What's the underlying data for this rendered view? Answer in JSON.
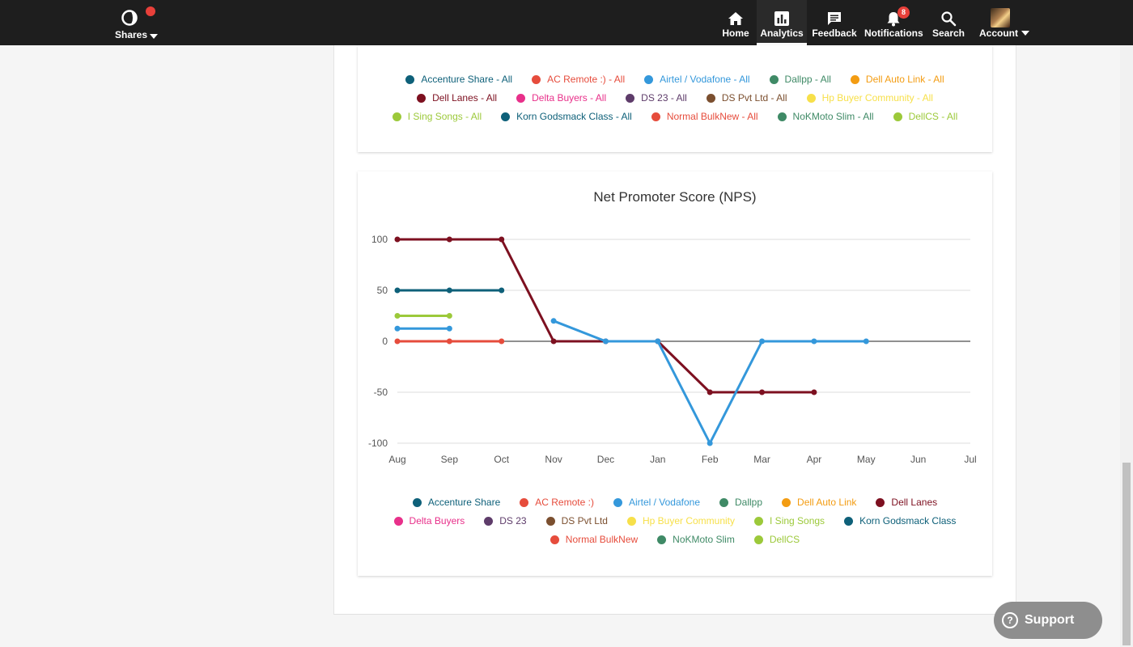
{
  "nav": {
    "brand_label": "Shares",
    "items": [
      {
        "label": "Home",
        "icon": "home-icon"
      },
      {
        "label": "Analytics",
        "icon": "analytics-icon"
      },
      {
        "label": "Feedback",
        "icon": "feedback-icon"
      },
      {
        "label": "Notifications",
        "icon": "bell-icon",
        "badge": "8"
      },
      {
        "label": "Search",
        "icon": "search-icon"
      },
      {
        "label": "Account",
        "icon": "avatar"
      }
    ]
  },
  "top_legend": [
    [
      {
        "label": "Accenture Share - All",
        "color": "#0e6079"
      },
      {
        "label": "AC Remote :) - All",
        "color": "#e64c3c"
      },
      {
        "label": "Airtel / Vodafone - All",
        "color": "#3498db"
      },
      {
        "label": "Dallpp - All",
        "color": "#3f8a66"
      },
      {
        "label": "Dell Auto Link - All",
        "color": "#f39c12"
      }
    ],
    [
      {
        "label": "Dell Lanes - All",
        "color": "#7d1020"
      },
      {
        "label": "Delta Buyers - All",
        "color": "#e8308a"
      },
      {
        "label": "DS 23 - All",
        "color": "#5e3c6a"
      },
      {
        "label": "DS Pvt Ltd - All",
        "color": "#7b4f2f"
      },
      {
        "label": "Hp Buyer Community - All",
        "color": "#f7e04a"
      }
    ],
    [
      {
        "label": "I Sing Songs - All",
        "color": "#9cc93a"
      },
      {
        "label": "Korn Godsmack Class - All",
        "color": "#0e6079"
      },
      {
        "label": "Normal BulkNew - All",
        "color": "#e64c3c"
      },
      {
        "label": "NoKMoto Slim - All",
        "color": "#3f8a66"
      },
      {
        "label": "DellCS - All",
        "color": "#9cc93a"
      }
    ]
  ],
  "nps_chart": {
    "title": "Net Promoter Score (NPS)",
    "legend": [
      [
        {
          "label": "Accenture Share",
          "color": "#0e6079"
        },
        {
          "label": "AC Remote :)",
          "color": "#e64c3c"
        },
        {
          "label": "Airtel / Vodafone",
          "color": "#3498db"
        },
        {
          "label": "Dallpp",
          "color": "#3f8a66"
        },
        {
          "label": "Dell Auto Link",
          "color": "#f39c12"
        },
        {
          "label": "Dell Lanes",
          "color": "#7d1020"
        }
      ],
      [
        {
          "label": "Delta Buyers",
          "color": "#e8308a"
        },
        {
          "label": "DS 23",
          "color": "#5e3c6a"
        },
        {
          "label": "DS Pvt Ltd",
          "color": "#7b4f2f"
        },
        {
          "label": "Hp Buyer Community",
          "color": "#f7e04a"
        },
        {
          "label": "I Sing Songs",
          "color": "#9cc93a"
        },
        {
          "label": "Korn Godsmack Class",
          "color": "#0e6079"
        }
      ],
      [
        {
          "label": "Normal BulkNew",
          "color": "#e64c3c"
        },
        {
          "label": "NoKMoto Slim",
          "color": "#3f8a66"
        },
        {
          "label": "DellCS",
          "color": "#9cc93a"
        }
      ]
    ]
  },
  "chart_data": {
    "type": "line",
    "title": "Net Promoter Score (NPS)",
    "xlabel": "",
    "ylabel": "",
    "categories": [
      "Aug",
      "Sep",
      "Oct",
      "Nov",
      "Dec",
      "Jan",
      "Feb",
      "Mar",
      "Apr",
      "May",
      "Jun",
      "Jul"
    ],
    "yticks": [
      100,
      50,
      0,
      -50,
      -100
    ],
    "ylim": [
      -100,
      100
    ],
    "grid": true,
    "legend_position": "bottom",
    "series": [
      {
        "name": "Dell Lanes",
        "color": "#7d1020",
        "values": [
          100,
          100,
          100,
          0,
          0,
          0,
          -50,
          -50,
          -50,
          null,
          null,
          null
        ]
      },
      {
        "name": "Accenture Share",
        "color": "#0e6079",
        "values": [
          50,
          50,
          50,
          null,
          null,
          null,
          null,
          null,
          null,
          null,
          null,
          null
        ]
      },
      {
        "name": "I Sing Songs",
        "color": "#9cc93a",
        "values": [
          25,
          25,
          null,
          null,
          null,
          null,
          null,
          null,
          null,
          null,
          null,
          null
        ]
      },
      {
        "name": "AC Remote :)",
        "color": "#e64c3c",
        "values": [
          0,
          0,
          0,
          null,
          null,
          null,
          null,
          null,
          null,
          null,
          null,
          null
        ]
      },
      {
        "name": "Airtel / Vodafone",
        "color": "#3498db",
        "values": [
          12.5,
          12.5,
          null,
          20,
          0,
          0,
          -100,
          0,
          0,
          0,
          null,
          null
        ]
      }
    ]
  },
  "support": {
    "label": "Support",
    "icon": "?"
  }
}
